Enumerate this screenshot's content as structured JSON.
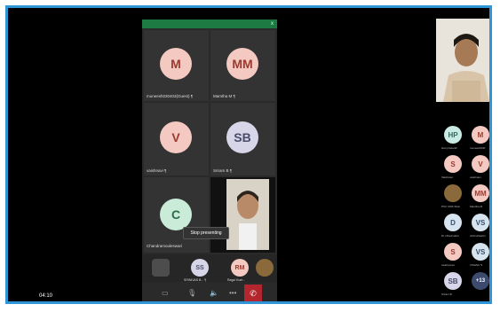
{
  "meeting": {
    "close_glyph": "x",
    "tiles": [
      {
        "initials": "M",
        "name": "muneesh030403(Guest) ¶",
        "bg": "#f3c9c2",
        "fg": "#9a3b2f"
      },
      {
        "initials": "MM",
        "name": "Mamtha M ¶",
        "bg": "#f3c9c2",
        "fg": "#9a3b2f"
      },
      {
        "initials": "V",
        "name": "vaishnavi ¶",
        "bg": "#f3c9c2",
        "fg": "#9a3b2f"
      },
      {
        "initials": "SB",
        "name": "Sriram B ¶",
        "bg": "#d6d6e8",
        "fg": "#4b4b6a"
      },
      {
        "initials": "C",
        "name": "Chandramouleswari",
        "bg": "#c9ebd7",
        "fg": "#2e6c48"
      }
    ],
    "tooltip": "Stop presenting",
    "bottom_row": [
      {
        "initials": "SS",
        "name": "SRINIVAS B... ¶",
        "bg": "#d6d6e8",
        "fg": "#4b4b6a"
      },
      {
        "initials": "RM",
        "name": "Ragul Kum...",
        "bg": "#f3c9c2",
        "fg": "#9a3b2f"
      }
    ],
    "controls": {
      "camera_icon": "camera-off-icon",
      "mic_icon": "mic-off-icon",
      "speaker_icon": "speaker-icon",
      "more_label": "•••",
      "end_icon": "end-call-icon"
    }
  },
  "participants": [
    {
      "initials": "HP",
      "name": "Hari prasanth",
      "bg": "#c9ebe4",
      "fg": "#2e6c5e"
    },
    {
      "initials": "M",
      "name": "muneesh030",
      "bg": "#f3c9c2",
      "fg": "#9a3b2f"
    },
    {
      "initials": "S",
      "name": "Vaishnavi",
      "bg": "#f3c9c2",
      "fg": "#9a3b2f"
    },
    {
      "initials": "V",
      "name": "vaishnavi",
      "bg": "#f3c9c2",
      "fg": "#9a3b2f"
    },
    {
      "initials": "",
      "name": "PSV CMS Shwi",
      "bg": "#8a6a3a",
      "fg": "#fff"
    },
    {
      "initials": "MM",
      "name": "Mamtha M",
      "bg": "#f3c9c2",
      "fg": "#9a3b2f"
    },
    {
      "initials": "D",
      "name": "Dr.J.Ravindran",
      "bg": "#d6e4f0",
      "fg": "#34506a"
    },
    {
      "initials": "VS",
      "name": "vishnuhaarini",
      "bg": "#d6e4f0",
      "fg": "#34506a"
    },
    {
      "initials": "S",
      "name": "swathy/ece",
      "bg": "#f3c9c2",
      "fg": "#9a3b2f"
    },
    {
      "initials": "VS",
      "name": "VISHNU S",
      "bg": "#d6e4f0",
      "fg": "#34506a"
    },
    {
      "initials": "SB",
      "name": "Sriram B",
      "bg": "#d6d6e8",
      "fg": "#4b4b6a"
    },
    {
      "initials": "+13",
      "name": "",
      "bg": "#3c4a6e",
      "fg": "#fff"
    }
  ],
  "playback": {
    "time": "04:10"
  }
}
